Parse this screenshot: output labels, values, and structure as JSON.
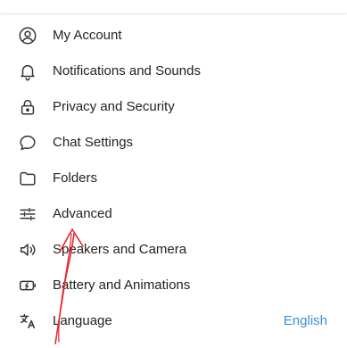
{
  "settings_menu": {
    "items": [
      {
        "label": "My Account",
        "icon": "account-circle-icon"
      },
      {
        "label": "Notifications and Sounds",
        "icon": "bell-icon"
      },
      {
        "label": "Privacy and Security",
        "icon": "lock-icon"
      },
      {
        "label": "Chat Settings",
        "icon": "chat-bubble-icon"
      },
      {
        "label": "Folders",
        "icon": "folder-icon"
      },
      {
        "label": "Advanced",
        "icon": "sliders-icon"
      },
      {
        "label": "Speakers and Camera",
        "icon": "speaker-icon"
      },
      {
        "label": "Battery and Animations",
        "icon": "battery-icon"
      },
      {
        "label": "Language",
        "icon": "translate-icon",
        "value": "English"
      }
    ],
    "colors": {
      "text": "#222222",
      "icon": "#333333",
      "accent": "#3a8fd6",
      "annotation": "#e8262b"
    }
  }
}
